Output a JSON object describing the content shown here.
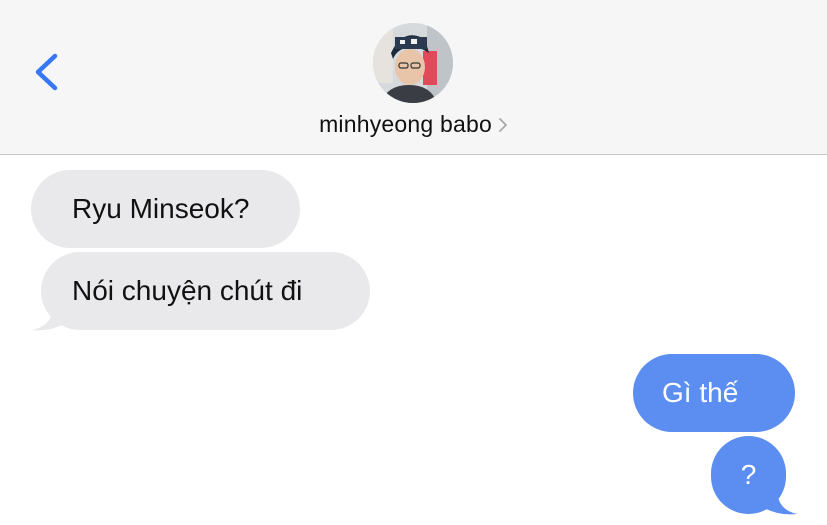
{
  "header": {
    "contact_name": "minhyeong babo",
    "back_icon": "chevron-left-icon",
    "detail_icon": "chevron-right-icon"
  },
  "messages": [
    {
      "direction": "incoming",
      "text": "Ryu Minseok?"
    },
    {
      "direction": "incoming",
      "text": "Nói chuyện chút đi"
    },
    {
      "direction": "outgoing",
      "text": "Gì thế"
    },
    {
      "direction": "outgoing",
      "text": "?"
    }
  ],
  "colors": {
    "accent": "#3478f6",
    "incoming_bubble": "#e9e9eb",
    "outgoing_bubble": "#5b8ef0",
    "header_bg": "#f6f6f6"
  }
}
